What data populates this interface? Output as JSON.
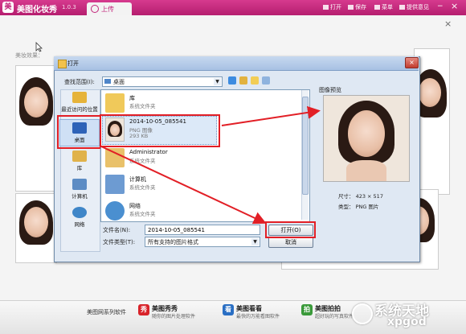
{
  "app": {
    "logo_glyph": "美",
    "title": "美图化妆秀",
    "version": "1.0.3",
    "upload_tab": "上传"
  },
  "toolbar": {
    "open": "打开",
    "save": "保存",
    "menu": "菜单",
    "hint": "提供意见"
  },
  "window": {
    "min": "−",
    "close": "×"
  },
  "main": {
    "close_glyph": "×",
    "beauty_label": "美妆效果："
  },
  "dialog": {
    "title": "打开",
    "close_glyph": "×",
    "lookin_label": "查找范围(I):",
    "lookin_value": "桌面",
    "dropdown_glyph": "▼",
    "places": [
      {
        "label": "最近访问的位置",
        "icon": "recent-places-icon",
        "color": "#e6b33a"
      },
      {
        "label": "桌面",
        "icon": "desktop-icon",
        "color": "#2e63b8"
      },
      {
        "label": "库",
        "icon": "library-icon",
        "color": "#e0b24a"
      },
      {
        "label": "计算机",
        "icon": "computer-icon",
        "color": "#5d8cc4"
      },
      {
        "label": "网络",
        "icon": "network-icon",
        "color": "#3f86c8"
      }
    ],
    "files": [
      {
        "name": "库",
        "desc": "系统文件夹",
        "size": "",
        "icon": "library-folder-icon"
      },
      {
        "name": "2014-10-05_085541",
        "desc": "PNG 图像",
        "size": "293 KB",
        "icon": "image-file-icon"
      },
      {
        "name": "Administrator",
        "desc": "系统文件夹",
        "size": "",
        "icon": "user-folder-icon"
      },
      {
        "name": "计算机",
        "desc": "系统文件夹",
        "size": "",
        "icon": "computer-icon"
      },
      {
        "name": "网络",
        "desc": "系统文件夹",
        "size": "",
        "icon": "network-icon"
      }
    ],
    "preview_label": "图像预览",
    "size_info": "尺寸： 423 × 517",
    "type_info": "类型： PNG 图片",
    "filename_label": "文件名(N):",
    "filename_value": "2014-10-05_085541",
    "filetype_label": "文件类型(T):",
    "filetype_value": "所有支持的图片格式",
    "open_button": "打开(O)",
    "cancel_button": "取消"
  },
  "bottombar": {
    "series_label": "美图网系列软件",
    "products": [
      {
        "glyph": "秀",
        "name": "美图秀秀",
        "desc": "随你的图片处理软件",
        "color": "#d8232a"
      },
      {
        "glyph": "看",
        "name": "美图看看",
        "desc": "最快的万能看图软件",
        "color": "#2a6fc4"
      },
      {
        "glyph": "拍",
        "name": "美图拍拍",
        "desc": "超好玩的写真软件",
        "color": "#3a9a3a"
      }
    ],
    "watermark": "系统天地",
    "watermark_sub": "xpgod"
  },
  "colors": {
    "brand": "#c2247a",
    "highlight": "#e21f26"
  }
}
